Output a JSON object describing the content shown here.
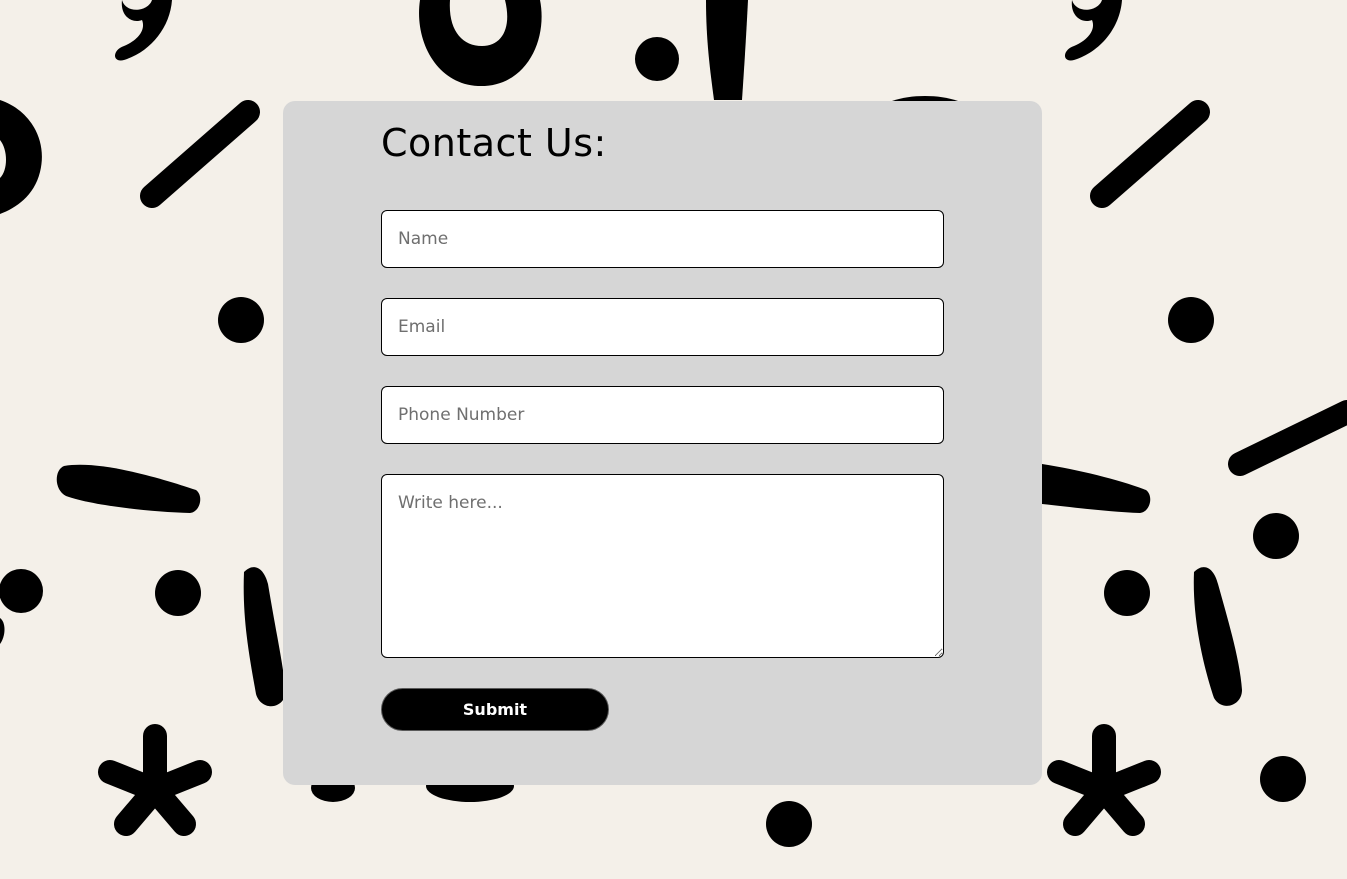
{
  "colors": {
    "page_background": "#f4f0e9",
    "card_background": "#d6d6d6",
    "doodle_color": "#000000",
    "button_background": "#000000",
    "button_text": "#ffffff"
  },
  "background": {
    "icon": "punctuation-doodle-pattern"
  },
  "form": {
    "title": "Contact Us:",
    "name_placeholder": "Name",
    "email_placeholder": "Email",
    "phone_placeholder": "Phone Number",
    "message_placeholder": "Write here...",
    "submit_label": "Submit"
  }
}
